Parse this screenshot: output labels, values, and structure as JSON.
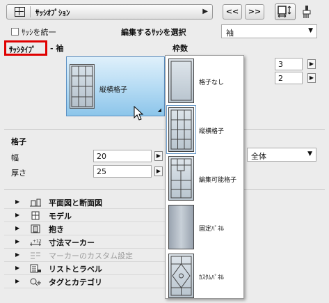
{
  "toolbar": {
    "title": "ｻｯｼｵﾌﾟｼｮﾝ",
    "dropdown_arrow": "▶",
    "prev_label": "<<",
    "next_label": ">>"
  },
  "unify": {
    "checkbox_label": "ｻｯｼを統一",
    "checked": false
  },
  "sash_select": {
    "label": "編集するｻｯｼを選択",
    "value": "袖",
    "arrow": "▼"
  },
  "sash_type": {
    "label": "ｻｯｼﾀｲﾌﾟ",
    "separator": "-",
    "sash_name": "袖",
    "selected_tile_label": "縦横格子"
  },
  "frames": {
    "label": "枠数",
    "value1": "3",
    "value2": "2"
  },
  "grid": {
    "section_title": "格子",
    "width_label": "幅",
    "width_value": "20",
    "thickness_label": "厚さ",
    "thickness_value": "25",
    "scope_value": "全体",
    "arrow": "▶"
  },
  "panels": [
    {
      "label": "平面図と断面図",
      "icon": "plan-section-icon",
      "dim": false
    },
    {
      "label": "モデル",
      "icon": "model-icon",
      "dim": false
    },
    {
      "label": "抱き",
      "icon": "reveal-icon",
      "dim": false
    },
    {
      "label": "寸法マーカー",
      "icon": "dimension-marker-icon",
      "dim": false
    },
    {
      "label": "マーカーのカスタム設定",
      "icon": "marker-custom-icon",
      "dim": true
    },
    {
      "label": "リストとラベル",
      "icon": "list-label-icon",
      "dim": false
    },
    {
      "label": "タグとカテゴリ",
      "icon": "tag-category-icon",
      "dim": false
    }
  ],
  "popup_options": [
    {
      "label": "格子なし",
      "selected": false
    },
    {
      "label": "縦横格子",
      "selected": true
    },
    {
      "label": "編集可能格子",
      "selected": false
    },
    {
      "label": "固定ﾊﾟﾈﾙ",
      "selected": false
    },
    {
      "label": "ｶｽﾀﾑﾊﾟﾈﾙ",
      "selected": false
    }
  ],
  "colors": {
    "highlight_border": "#e00000",
    "tile_blue": "#8cc5ea",
    "selection_outline": "#6a9ac8"
  }
}
